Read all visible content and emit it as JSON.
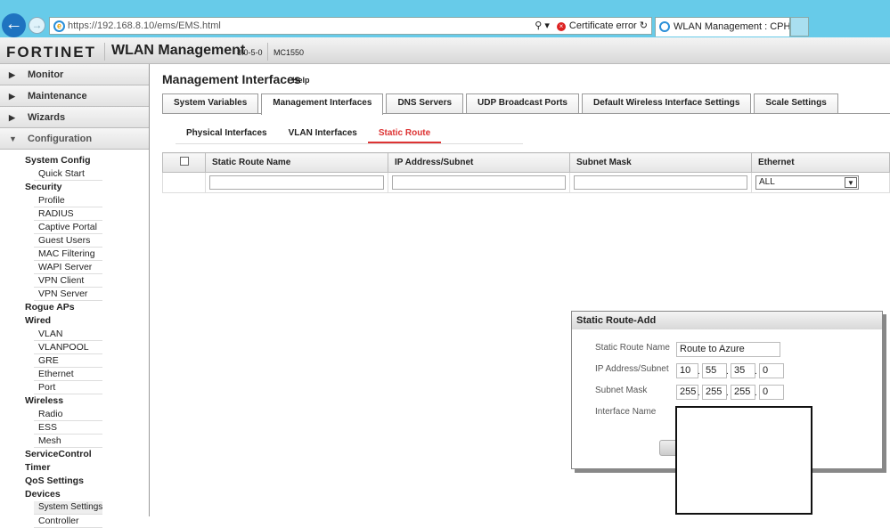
{
  "browser": {
    "url": "https://192.168.8.10/ems/EMS.html",
    "url_host": "192.168.8.10",
    "cert_error": "Certificate error",
    "tab_title": "WLAN Management : CPH-..."
  },
  "header": {
    "logo": "FORTINET",
    "app": "WLAN Management",
    "version": "8.0-5-0",
    "model": "MC1550"
  },
  "sidebar": {
    "accordion": [
      {
        "label": "Monitor",
        "open": false
      },
      {
        "label": "Maintenance",
        "open": false
      },
      {
        "label": "Wizards",
        "open": false
      },
      {
        "label": "Configuration",
        "open": true
      }
    ],
    "tree": [
      {
        "group": "System Config",
        "items": [
          "Quick Start"
        ]
      },
      {
        "group": "Security",
        "items": [
          "Profile",
          "RADIUS",
          "Captive Portal",
          "Guest Users",
          "MAC Filtering",
          "WAPI Server",
          "VPN Client",
          "VPN Server"
        ]
      },
      {
        "group": "Rogue APs",
        "items": []
      },
      {
        "group": "Wired",
        "items": [
          "VLAN",
          "VLANPOOL",
          "GRE",
          "Ethernet",
          "Port"
        ]
      },
      {
        "group": "Wireless",
        "items": [
          "Radio",
          "ESS",
          "Mesh"
        ]
      },
      {
        "group": "ServiceControl",
        "items": []
      },
      {
        "group": "Timer",
        "items": []
      },
      {
        "group": "QoS Settings",
        "items": []
      },
      {
        "group": "Devices",
        "items": [
          "System Settings",
          "Controller"
        ]
      }
    ],
    "selected": "System Settings"
  },
  "main": {
    "title": "Management Interfaces",
    "help": "Help",
    "tabs": [
      "System Variables",
      "Management Interfaces",
      "DNS Servers",
      "UDP Broadcast Ports",
      "Default Wireless Interface Settings",
      "Scale Settings"
    ],
    "active_tab": 1,
    "subtabs": [
      "Physical Interfaces",
      "VLAN Interfaces",
      "Static Route"
    ],
    "active_subtab": 2,
    "columns": [
      "Static Route Name",
      "IP Address/Subnet",
      "Subnet Mask",
      "Ethernet"
    ],
    "filter": {
      "ethernet": "ALL"
    }
  },
  "dialog": {
    "title": "Static Route-Add",
    "name_label": "Static Route Name",
    "name_value": "Route to Azure",
    "ip_label": "IP Address/Subnet",
    "ip": [
      "10",
      "55",
      "35",
      "0"
    ],
    "mask_label": "Subnet Mask",
    "mask": [
      "255",
      "255",
      "255",
      "0"
    ],
    "iface_label": "Interface Name"
  },
  "colors": {
    "chrome": "#67cbe9",
    "accent": "#dd3333"
  }
}
